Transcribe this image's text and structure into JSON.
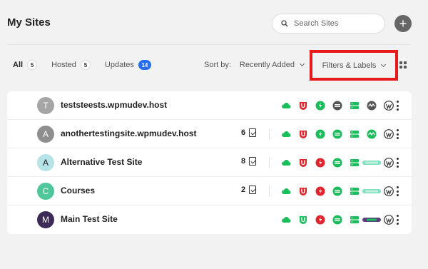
{
  "header": {
    "title": "My Sites"
  },
  "search": {
    "placeholder": "Search Sites",
    "icon": "search-icon"
  },
  "add_button": {
    "label": "+"
  },
  "tabs": [
    {
      "label": "All",
      "count": "5",
      "active": true
    },
    {
      "label": "Hosted",
      "count": "5",
      "active": false
    },
    {
      "label": "Updates",
      "count": "14",
      "active": false
    }
  ],
  "sort": {
    "label": "Sort by:",
    "value": "Recently Added"
  },
  "filters": {
    "label": "Filters & Labels"
  },
  "colors": {
    "green": "#1abc5b",
    "red": "#e0242b",
    "blue": "#286ef1",
    "highlight": "#e8191a"
  },
  "sites": [
    {
      "initial": "T",
      "name": "teststeests.wpmudev.host",
      "updates": "",
      "avatar_bg": "#a5a5a5",
      "avatar_fg": "#ffffff",
      "status": "normal"
    },
    {
      "initial": "A",
      "name": "anothertestingsite.wpmudev.host",
      "updates": "6",
      "avatar_bg": "#8e8e8e",
      "avatar_fg": "#ffffff",
      "status": "green"
    },
    {
      "initial": "A",
      "name": "Alternative Test Site",
      "updates": "8",
      "avatar_bg": "#b5e3e8",
      "avatar_fg": "#1a1a1a",
      "status": "teal"
    },
    {
      "initial": "C",
      "name": "Courses",
      "updates": "2",
      "avatar_bg": "#4fc79a",
      "avatar_fg": "#ffffff",
      "status": "teal"
    },
    {
      "initial": "M",
      "name": "Main Test Site",
      "updates": "",
      "avatar_bg": "#3c2a57",
      "avatar_fg": "#ffffff",
      "status": "purple"
    }
  ],
  "service_icons": [
    "cloud-icon",
    "defender-icon",
    "smush-icon",
    "hummingbird-icon",
    "hosting-icon",
    "uptime-icon",
    "wordpress-icon"
  ]
}
